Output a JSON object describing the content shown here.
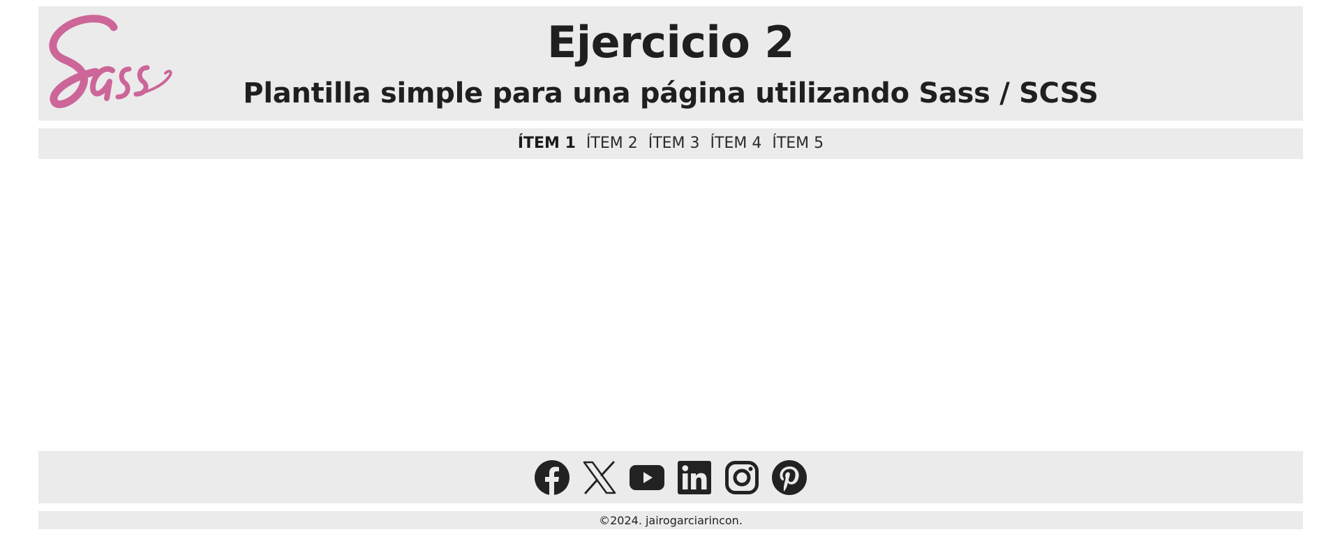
{
  "header": {
    "logo_text": "Sass",
    "title": "Ejercicio 2",
    "subtitle": "Plantilla simple para una página utilizando Sass / SCSS"
  },
  "nav": {
    "items": [
      {
        "label": "ÍTEM 1",
        "active": true
      },
      {
        "label": "ÍTEM 2",
        "active": false
      },
      {
        "label": "ÍTEM 3",
        "active": false
      },
      {
        "label": "ÍTEM 4",
        "active": false
      },
      {
        "label": "ÍTEM 5",
        "active": false
      }
    ]
  },
  "social": {
    "icons": [
      "facebook-icon",
      "x-twitter-icon",
      "youtube-icon",
      "linkedin-icon",
      "instagram-icon",
      "pinterest-icon"
    ]
  },
  "footer": {
    "copyright": "©2024. jairogarciarincon."
  },
  "colors": {
    "panel": "#ebebeb",
    "text": "#1f1f1f",
    "sass_pink": "#cc6699",
    "background": "#ffffff"
  }
}
